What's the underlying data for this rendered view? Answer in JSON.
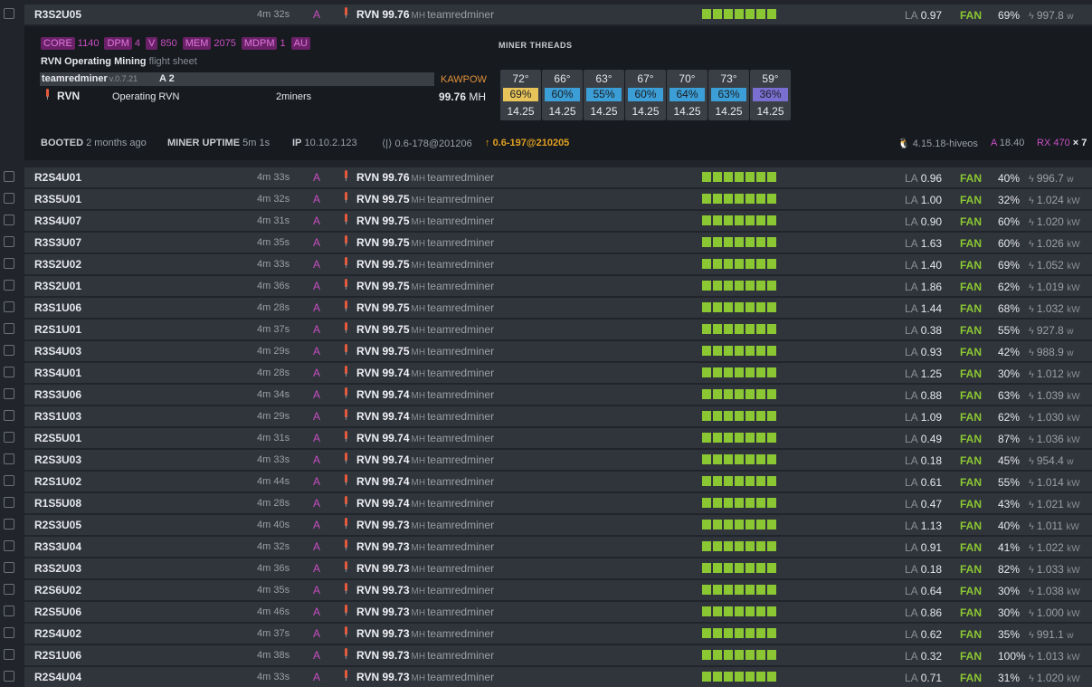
{
  "expanded": {
    "name": "R3S2U05",
    "uptime": "4m 32s",
    "agent": "A",
    "coin": "RVN",
    "hashrate": "99.76",
    "unit": "MH",
    "miner": "teamredminer",
    "la_label": "LA",
    "la": "0.97",
    "fan_label": "FAN",
    "fan": "69%",
    "power": "997.8",
    "power_unit": "w",
    "tags": [
      {
        "k": "CORE",
        "v": "1140"
      },
      {
        "k": "DPM",
        "v": "4"
      },
      {
        "k": "V",
        "v": "850"
      },
      {
        "k": "MEM",
        "v": "2075"
      },
      {
        "k": "MDPM",
        "v": "1"
      },
      {
        "k": "AU",
        "v": ""
      }
    ],
    "flight_sheet": "RVN Operating Mining",
    "flight_sheet_suffix": "flight sheet",
    "miner_name": "teamredminer",
    "miner_version": "v.0.7.21",
    "miner_a": "A 2",
    "algo": "KAWPOW",
    "coin_row": "RVN",
    "operating": "Operating RVN",
    "pool": "2miners",
    "total_hash": "99.76",
    "total_hash_unit": "MH",
    "threads_title": "MINER THREADS",
    "threads": [
      {
        "temp": "72°",
        "fan": "69%",
        "fan_color": "#e7c45a",
        "hash": "14.25"
      },
      {
        "temp": "66°",
        "fan": "60%",
        "fan_color": "#3c9ed6",
        "hash": "14.25"
      },
      {
        "temp": "63°",
        "fan": "55%",
        "fan_color": "#3c9ed6",
        "hash": "14.25"
      },
      {
        "temp": "67°",
        "fan": "60%",
        "fan_color": "#3c9ed6",
        "hash": "14.25"
      },
      {
        "temp": "70°",
        "fan": "64%",
        "fan_color": "#3c9ed6",
        "hash": "14.25"
      },
      {
        "temp": "73°",
        "fan": "63%",
        "fan_color": "#3c9ed6",
        "hash": "14.25"
      },
      {
        "temp": "59°",
        "fan": "36%",
        "fan_color": "#7a6fd0",
        "hash": "14.25"
      }
    ],
    "booted_label": "BOOTED",
    "booted": "2 months ago",
    "miner_uptime_label": "MINER UPTIME",
    "miner_uptime": "5m 1s",
    "ip_label": "IP",
    "ip": "10.10.2.123",
    "version_current": "0.6-178@201206",
    "version_new": "0.6-197@210205",
    "kernel": "4.15.18-hiveos",
    "amd_label": "A",
    "amd_version": "18.40",
    "gpu_model": "RX 470",
    "gpu_count": "× 7"
  },
  "rows": [
    {
      "name": "R2S4U01",
      "uptime": "4m 33s",
      "hash": "99.76",
      "la": "0.96",
      "fan": "40%",
      "power": "996.7",
      "punit": "w"
    },
    {
      "name": "R3S5U01",
      "uptime": "4m 32s",
      "hash": "99.75",
      "la": "1.00",
      "fan": "32%",
      "power": "1.024",
      "punit": "kW"
    },
    {
      "name": "R3S4U07",
      "uptime": "4m 31s",
      "hash": "99.75",
      "la": "0.90",
      "fan": "60%",
      "power": "1.020",
      "punit": "kW"
    },
    {
      "name": "R3S3U07",
      "uptime": "4m 35s",
      "hash": "99.75",
      "la": "1.63",
      "fan": "60%",
      "power": "1.026",
      "punit": "kW"
    },
    {
      "name": "R3S2U02",
      "uptime": "4m 33s",
      "hash": "99.75",
      "la": "1.40",
      "fan": "69%",
      "power": "1.052",
      "punit": "kW"
    },
    {
      "name": "R3S2U01",
      "uptime": "4m 36s",
      "hash": "99.75",
      "la": "1.86",
      "fan": "62%",
      "power": "1.019",
      "punit": "kW"
    },
    {
      "name": "R3S1U06",
      "uptime": "4m 28s",
      "hash": "99.75",
      "la": "1.44",
      "fan": "68%",
      "power": "1.032",
      "punit": "kW"
    },
    {
      "name": "R2S1U01",
      "uptime": "4m 37s",
      "hash": "99.75",
      "la": "0.38",
      "fan": "55%",
      "power": "927.8",
      "punit": "w"
    },
    {
      "name": "R3S4U03",
      "uptime": "4m 29s",
      "hash": "99.75",
      "la": "0.93",
      "fan": "42%",
      "power": "988.9",
      "punit": "w"
    },
    {
      "name": "R3S4U01",
      "uptime": "4m 28s",
      "hash": "99.74",
      "la": "1.25",
      "fan": "30%",
      "power": "1.012",
      "punit": "kW"
    },
    {
      "name": "R3S3U06",
      "uptime": "4m 34s",
      "hash": "99.74",
      "la": "0.88",
      "fan": "63%",
      "power": "1.039",
      "punit": "kW"
    },
    {
      "name": "R3S1U03",
      "uptime": "4m 29s",
      "hash": "99.74",
      "la": "1.09",
      "fan": "62%",
      "power": "1.030",
      "punit": "kW"
    },
    {
      "name": "R2S5U01",
      "uptime": "4m 31s",
      "hash": "99.74",
      "la": "0.49",
      "fan": "87%",
      "power": "1.036",
      "punit": "kW"
    },
    {
      "name": "R2S3U03",
      "uptime": "4m 33s",
      "hash": "99.74",
      "la": "0.18",
      "fan": "45%",
      "power": "954.4",
      "punit": "w"
    },
    {
      "name": "R2S1U02",
      "uptime": "4m 44s",
      "hash": "99.74",
      "la": "0.61",
      "fan": "55%",
      "power": "1.014",
      "punit": "kW"
    },
    {
      "name": "R1S5U08",
      "uptime": "4m 28s",
      "hash": "99.74",
      "la": "0.47",
      "fan": "43%",
      "power": "1.021",
      "punit": "kW"
    },
    {
      "name": "R2S3U05",
      "uptime": "4m 40s",
      "hash": "99.73",
      "la": "1.13",
      "fan": "40%",
      "power": "1.011",
      "punit": "kW"
    },
    {
      "name": "R3S3U04",
      "uptime": "4m 32s",
      "hash": "99.73",
      "la": "0.91",
      "fan": "41%",
      "power": "1.022",
      "punit": "kW"
    },
    {
      "name": "R3S2U03",
      "uptime": "4m 36s",
      "hash": "99.73",
      "la": "0.18",
      "fan": "82%",
      "power": "1.033",
      "punit": "kW"
    },
    {
      "name": "R2S6U02",
      "uptime": "4m 35s",
      "hash": "99.73",
      "la": "0.64",
      "fan": "30%",
      "power": "1.038",
      "punit": "kW"
    },
    {
      "name": "R2S5U06",
      "uptime": "4m 46s",
      "hash": "99.73",
      "la": "0.86",
      "fan": "30%",
      "power": "1.000",
      "punit": "kW"
    },
    {
      "name": "R2S4U02",
      "uptime": "4m 37s",
      "hash": "99.73",
      "la": "0.62",
      "fan": "35%",
      "power": "991.1",
      "punit": "w"
    },
    {
      "name": "R2S1U06",
      "uptime": "4m 38s",
      "hash": "99.73",
      "la": "0.32",
      "fan": "100%",
      "power": "1.013",
      "punit": "kW"
    },
    {
      "name": "R2S4U04",
      "uptime": "4m 33s",
      "hash": "99.73",
      "la": "0.71",
      "fan": "31%",
      "power": "1.020",
      "punit": "kW"
    }
  ],
  "row_common": {
    "agent": "A",
    "coin": "RVN",
    "unit": "MH",
    "miner": "teamredminer",
    "la_label": "LA",
    "fan_label": "FAN",
    "gpu_count_ok": 7
  },
  "colors": {
    "gpu_ok": "#8ac733",
    "agent": "#c84fc3",
    "fan": "#8ac733",
    "update": "#e0a020"
  }
}
